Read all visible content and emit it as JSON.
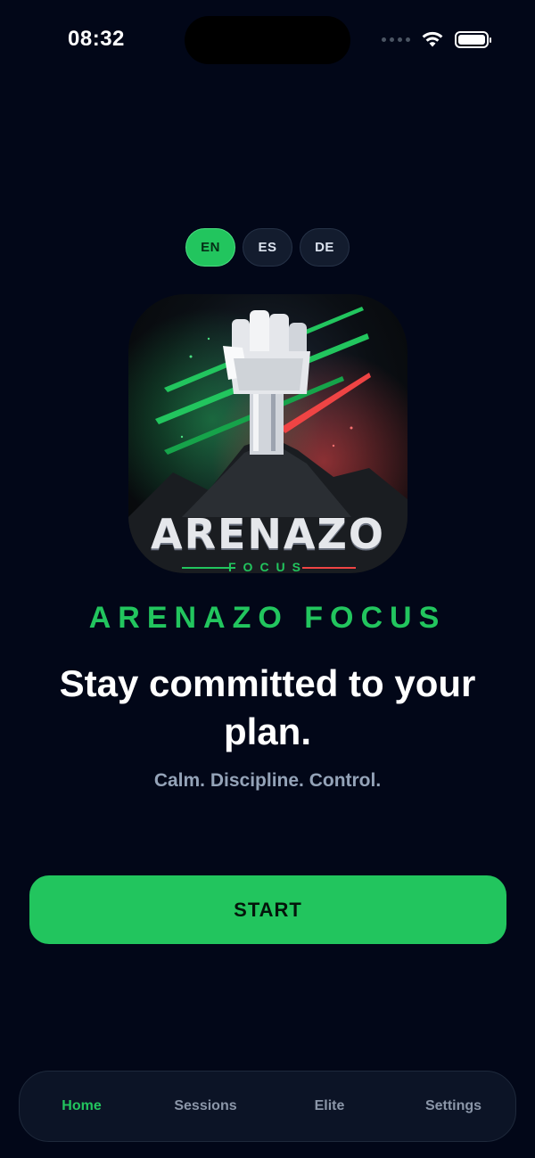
{
  "status_bar": {
    "time": "08:32"
  },
  "languages": [
    {
      "code": "EN",
      "active": true
    },
    {
      "code": "ES",
      "active": false
    },
    {
      "code": "DE",
      "active": false
    }
  ],
  "logo": {
    "wordmark": "ARENAZO",
    "sub": "FOCUS"
  },
  "app_name": "ARENAZO FOCUS",
  "headline": "Stay committed to your plan.",
  "tagline": "Calm. Discipline. Control.",
  "start_button": {
    "label": "START"
  },
  "tabs": [
    {
      "label": "Home",
      "active": true
    },
    {
      "label": "Sessions",
      "active": false
    },
    {
      "label": "Elite",
      "active": false
    },
    {
      "label": "Settings",
      "active": false
    }
  ],
  "colors": {
    "background": "#020718",
    "accent": "#22c55e",
    "muted": "#94a3b8",
    "tab_bar": "#0c1426"
  },
  "icons": [
    "wifi-icon",
    "battery-icon",
    "signal-icon",
    "raised-fist-icon"
  ]
}
